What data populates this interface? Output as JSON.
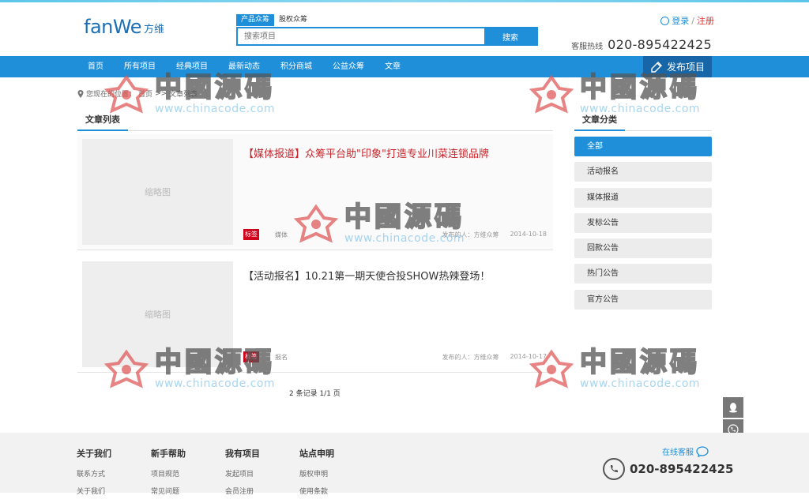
{
  "header": {
    "logo_en": "fanWe",
    "logo_cn": "方维",
    "search_tabs": [
      "产品众筹",
      "股权众筹"
    ],
    "search_placeholder": "搜索项目",
    "search_button": "搜索",
    "login": "登录",
    "login_sep": "/",
    "register": "注册",
    "hotline_label": "客服热线",
    "hotline_number": "020-895422425"
  },
  "nav": {
    "items": [
      "首页",
      "所有项目",
      "经典项目",
      "最新动态",
      "积分商城",
      "公益众筹",
      "文章"
    ],
    "publish": "发布项目"
  },
  "breadcrumb": {
    "prefix": "您现在的位置：",
    "home": "首页",
    "sep": ">>",
    "current": "文章列表"
  },
  "main": {
    "section_title": "文章列表",
    "articles": [
      {
        "thumb": "缩略图",
        "title": "【媒体报道】众筹平台助\"印象\"打造专业川菜连锁品牌",
        "tag": "标签",
        "tag_text": "媒体",
        "author": "发布的人：方维众筹",
        "date": "2014-10-18"
      },
      {
        "thumb": "缩略图",
        "title": "【活动报名】10.21第一期天使合投SHOW热辣登场！",
        "tag": "标签",
        "tag_text": "报名",
        "author": "发布的人：方维众筹",
        "date": "2014-10-17"
      }
    ],
    "pager": "2 条记录 1/1 页"
  },
  "sidebar": {
    "title": "文章分类",
    "items": [
      "全部",
      "活动报名",
      "媒体报道",
      "发标公告",
      "回款公告",
      "热门公告",
      "官方公告"
    ]
  },
  "footer": {
    "cols": [
      {
        "title": "关于我们",
        "links": [
          "联系方式",
          "关于我们"
        ]
      },
      {
        "title": "新手帮助",
        "links": [
          "项目规范",
          "常见问题"
        ]
      },
      {
        "title": "我有项目",
        "links": [
          "发起项目",
          "会员注册"
        ]
      },
      {
        "title": "站点申明",
        "links": [
          "版权申明",
          "使用条款"
        ]
      }
    ],
    "online_service": "在线客服",
    "phone": "020-895422425"
  },
  "watermark": {
    "cn": "中國源碼",
    "en": "www.chinacode.com"
  },
  "colors": {
    "accent": "#1f8fd9",
    "nav_dark": "#1767a8",
    "tag_red": "#d0021b",
    "title_red": "#c7252b"
  }
}
